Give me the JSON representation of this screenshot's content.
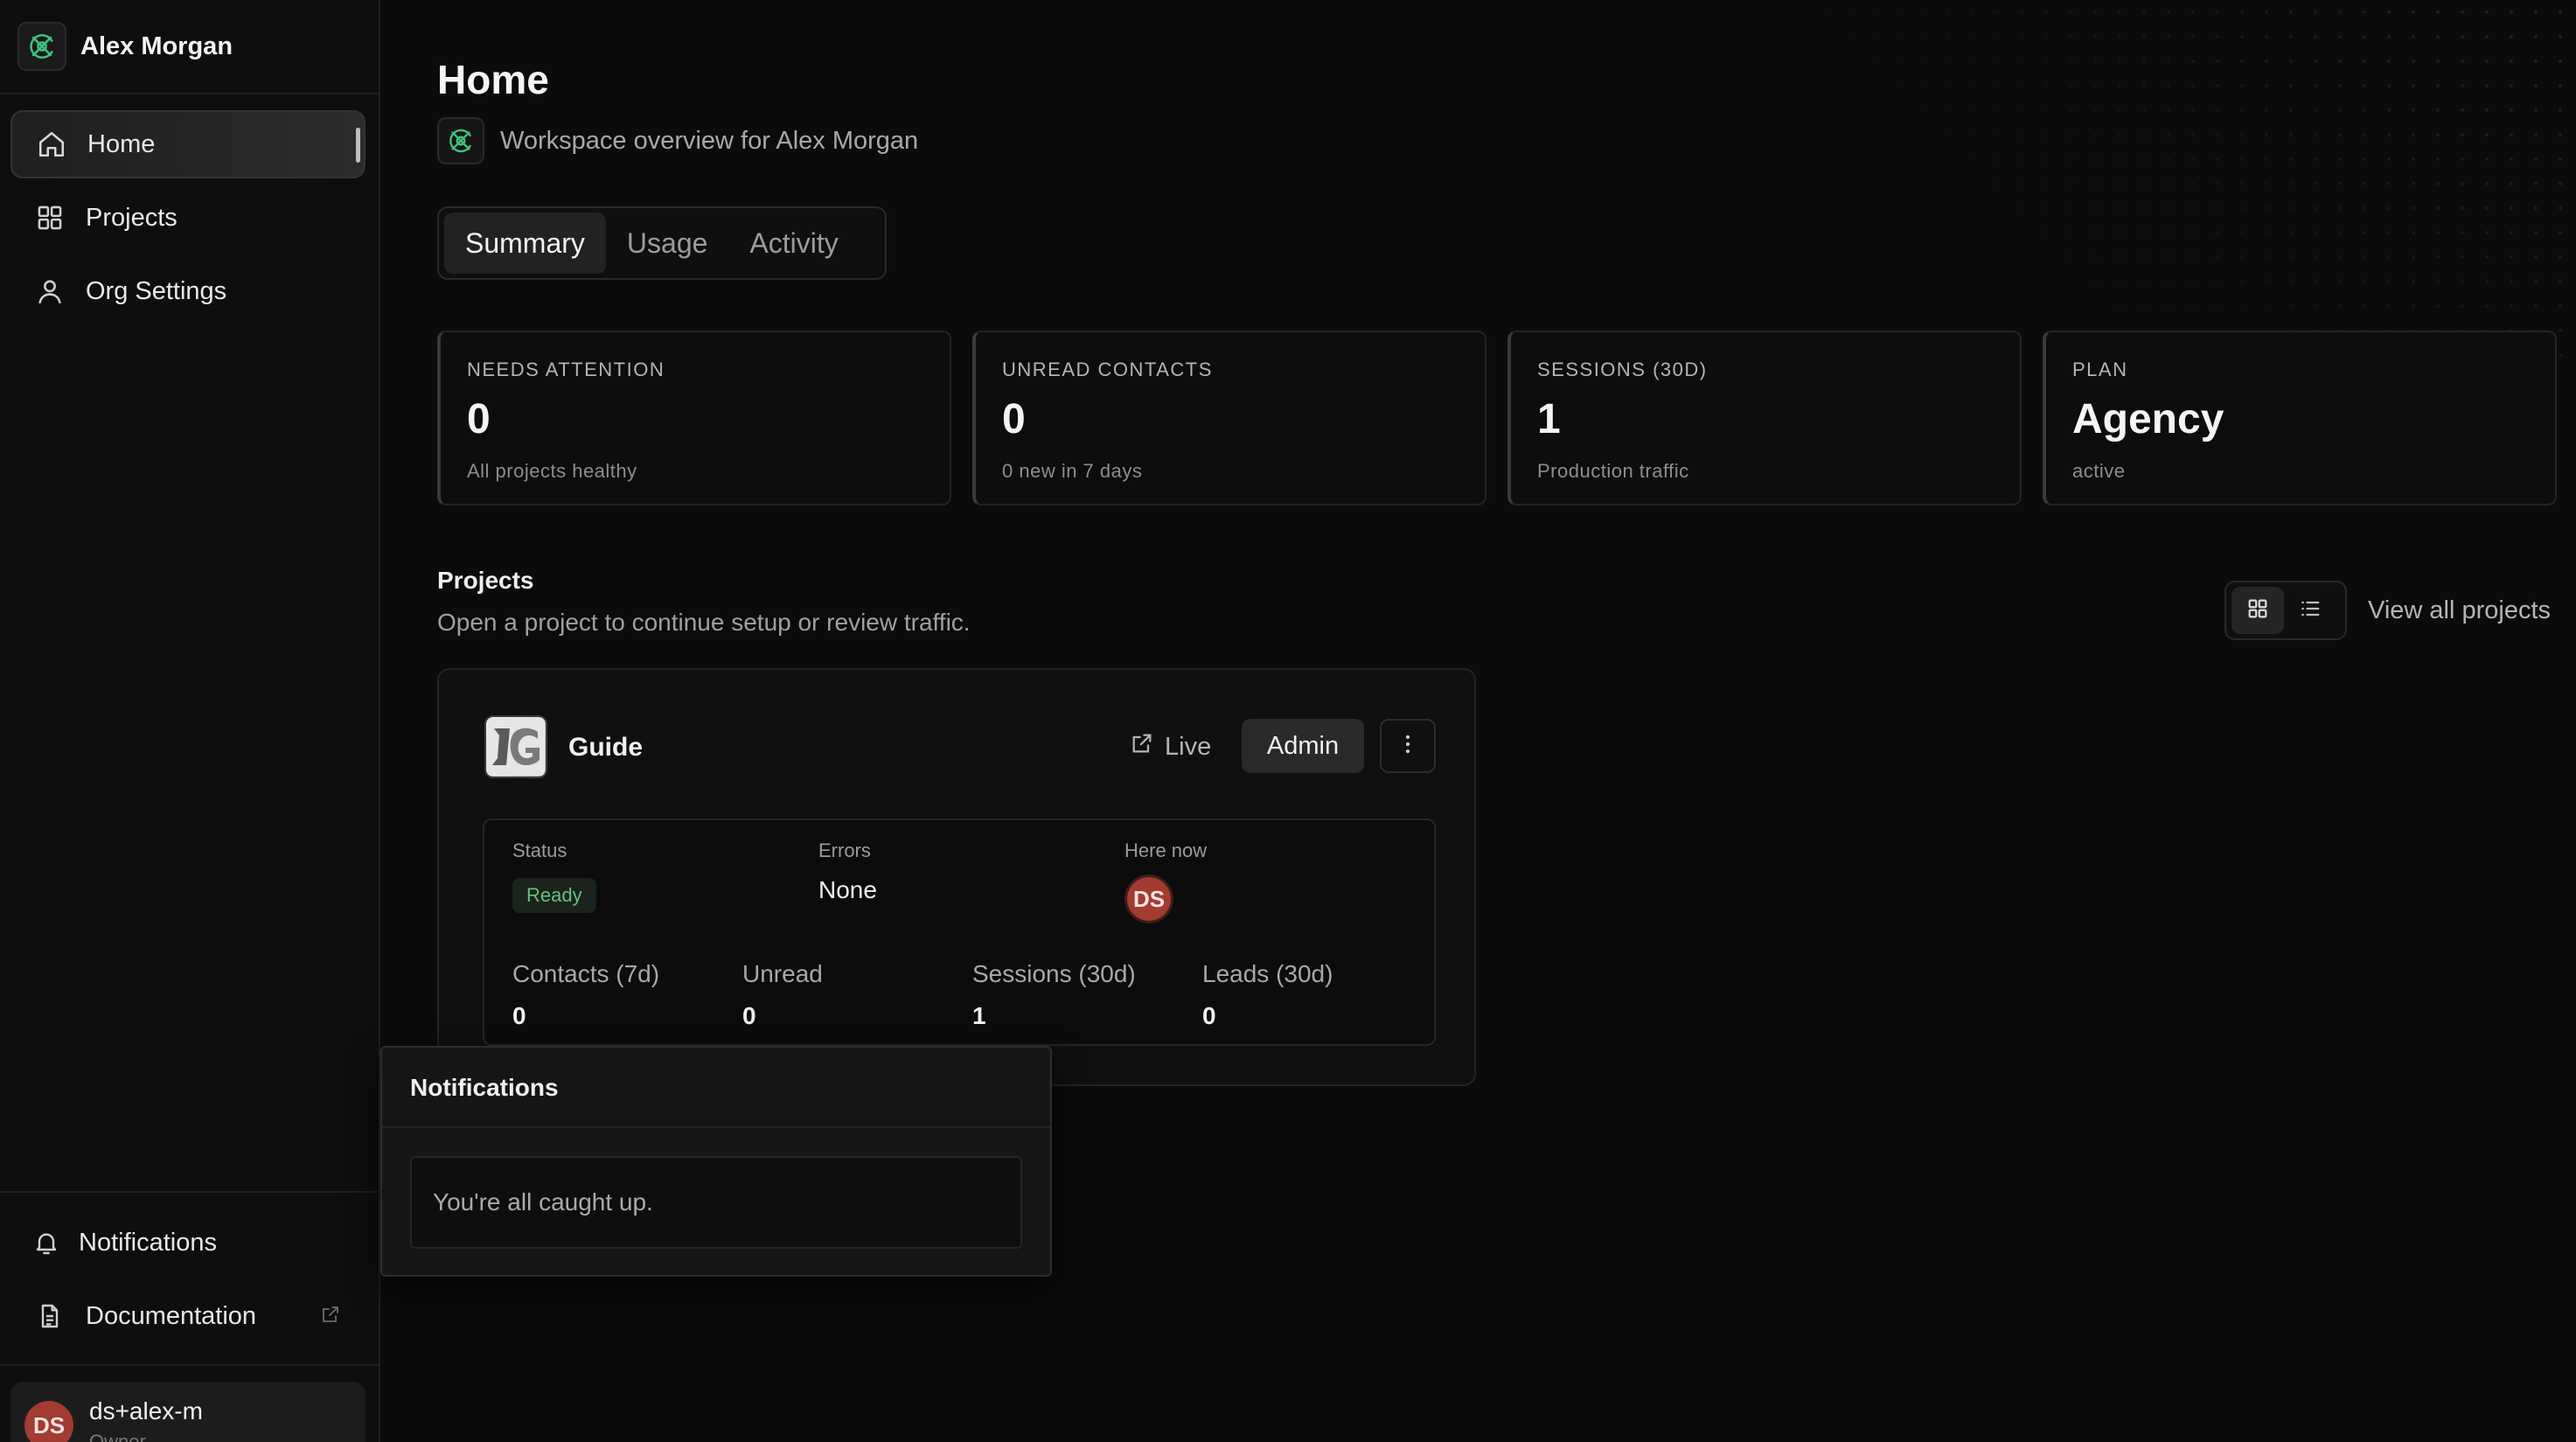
{
  "org": {
    "name": "Alex Morgan"
  },
  "nav": {
    "items": [
      {
        "label": "Home",
        "icon": "home-icon",
        "active": true
      },
      {
        "label": "Projects",
        "icon": "grid-icon",
        "active": false
      },
      {
        "label": "Org Settings",
        "icon": "user-icon",
        "active": false
      }
    ],
    "bottom": [
      {
        "label": "Notifications",
        "icon": "bell-icon"
      },
      {
        "label": "Documentation",
        "icon": "document-icon"
      }
    ]
  },
  "user": {
    "initials": "DS",
    "name": "ds+alex-m",
    "role": "Owner"
  },
  "page": {
    "title": "Home",
    "subtitle": "Workspace overview for Alex Morgan",
    "tabs": [
      "Summary",
      "Usage",
      "Activity"
    ],
    "active_tab": "Summary"
  },
  "stats": [
    {
      "label": "NEEDS ATTENTION",
      "value": "0",
      "sub": "All projects healthy"
    },
    {
      "label": "UNREAD CONTACTS",
      "value": "0",
      "sub": "0 new in 7 days"
    },
    {
      "label": "SESSIONS (30D)",
      "value": "1",
      "sub": "Production traffic"
    },
    {
      "label": "PLAN",
      "value": "Agency",
      "sub": "active"
    }
  ],
  "projects": {
    "title": "Projects",
    "subtitle": "Open a project to continue setup or review traffic.",
    "view_all": "View all projects",
    "card": {
      "name": "Guide",
      "live_label": "Live",
      "admin_label": "Admin",
      "status_label": "Status",
      "status_value": "Ready",
      "errors_label": "Errors",
      "errors_value": "None",
      "here_now_label": "Here now",
      "here_now_initials": "DS",
      "metrics": [
        {
          "label": "Contacts (7d)",
          "value": "0"
        },
        {
          "label": "Unread",
          "value": "0"
        },
        {
          "label": "Sessions (30d)",
          "value": "1"
        },
        {
          "label": "Leads (30d)",
          "value": "0"
        }
      ]
    }
  },
  "notifications": {
    "title": "Notifications",
    "empty": "You're all caught up."
  },
  "colors": {
    "background": "#0b0b0b",
    "accent_green": "#63c27a",
    "avatar_red": "#a23b30",
    "logo_green": "#3fc27d"
  }
}
